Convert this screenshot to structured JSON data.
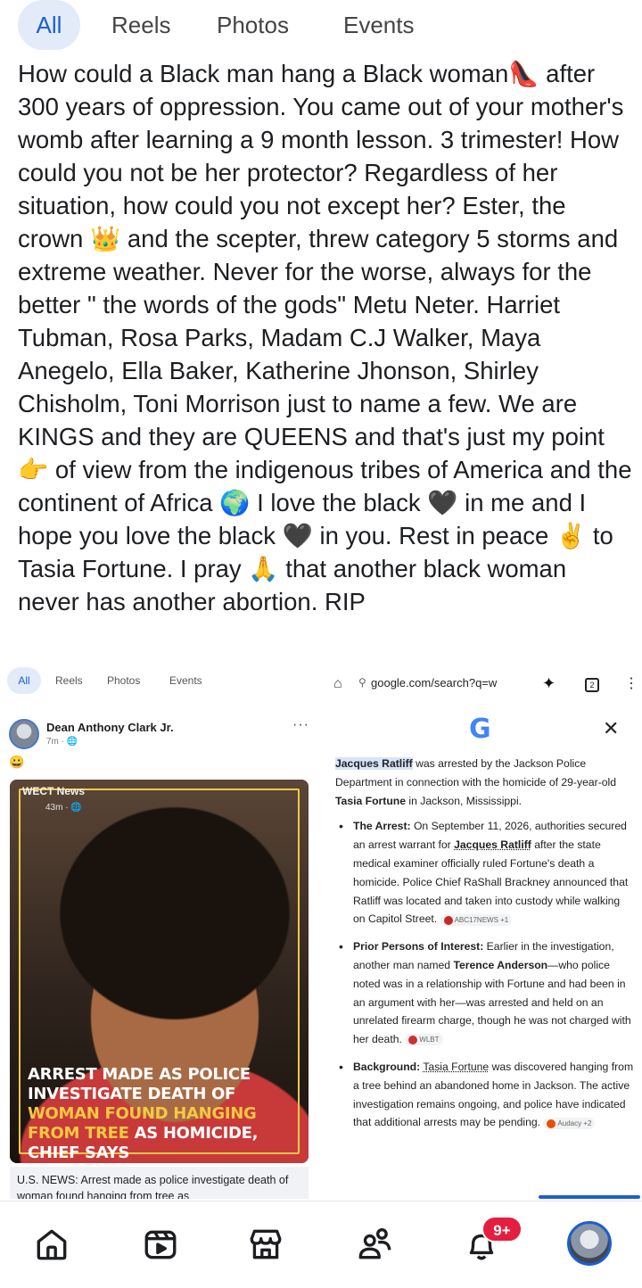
{
  "top_tabs": [
    "All",
    "Reels",
    "Photos",
    "Events"
  ],
  "post": {
    "segments": [
      {
        "t": "How could a Black man hang a Black woman"
      },
      {
        "e": "👠"
      },
      {
        "t": " after 300 years of oppression. You came out of your mother's womb after learning a 9 month lesson. 3 trimester! How could you not be her protector? Regardless of her situation, how could you not except her? Ester, the crown "
      },
      {
        "e": "👑"
      },
      {
        "t": " and the scepter, threw category 5 storms and extreme weather. Never for the worse, always for the better \" the words of the gods\" Metu Neter. Harriet Tubman, Rosa Parks, Madam C.J Walker, Maya Anegelo, Ella Baker, Katherine Jhonson, Shirley Chisholm, Toni Morrison just to name a few. We are KINGS and they are QUEENS and that's just my point "
      },
      {
        "e": "👉"
      },
      {
        "t": " of view from the indigenous tribes of America and the continent of Africa "
      },
      {
        "e": "🌍"
      },
      {
        "t": " I love the black "
      },
      {
        "e": "🖤"
      },
      {
        "t": " in me and I hope you love the black "
      },
      {
        "e": "🖤"
      },
      {
        "t": " in you. Rest in peace "
      },
      {
        "e": "✌"
      },
      {
        "t": " to Tasia Fortune. I pray "
      },
      {
        "e": "🙏"
      },
      {
        "t": " that another black woman never has another abortion. RIP"
      }
    ]
  },
  "embedded_fb": {
    "tabs": [
      "All",
      "Reels",
      "Photos",
      "Events"
    ],
    "author": "Dean Anthony Clark Jr.",
    "meta": "7m · 🌐",
    "more": "···",
    "emoji": "😀",
    "card": {
      "source": "WECT News",
      "time": "43m · 🌐",
      "headline_a": "ARREST MADE AS POLICE INVESTIGATE DEATH OF ",
      "headline_b": "WOMAN FOUND HANGING FROM TREE",
      "headline_c": " AS HOMICIDE, CHIEF SAYS"
    },
    "caption": "U.S. NEWS: Arrest made as police investigate death of woman found hanging from tree as"
  },
  "embedded_google": {
    "url": "google.com/search?q=w",
    "tab_count": "2",
    "logo": "G",
    "intro_a": "Jacques Ratliff",
    "intro_b": " was arrested by the Jackson Police Department in connection with the homicide of 29-year-old ",
    "intro_c": "Tasia Fortune",
    "intro_d": " in Jackson, Mississippi.",
    "b1_title": "The Arrest:",
    "b1_a": " On September 11, 2026, authorities secured an arrest warrant for ",
    "b1_b": "Jacques Ratliff",
    "b1_c": " after the state medical examiner officially ruled Fortune's death a homicide. Police Chief RaShall Brackney announced that Ratliff was located and taken into custody while walking on Capitol Street.",
    "b1_src": "ABC17NEWS +1",
    "b2_title": "Prior Persons of Interest:",
    "b2_a": " Earlier in the investigation, another man named ",
    "b2_b": "Terence Anderson",
    "b2_c": "—who police noted was in a relationship with Fortune and had been in an argument with her—was arrested and held on an unrelated firearm charge, though he was not charged with her death.",
    "b2_src": "WLBT",
    "b3_title": "Background:",
    "b3_a": "Tasia Fortune",
    "b3_b": " was discovered hanging from a tree behind an abandoned home in Jackson. The active investigation remains ongoing, and police have indicated that additional arrests may be pending.",
    "b3_src": "Audacy +2"
  },
  "bottom_nav": {
    "items": [
      "home-icon",
      "video-icon",
      "marketplace-icon",
      "friends-icon",
      "notifications-icon",
      "profile-avatar"
    ],
    "notification_badge": "9+"
  },
  "colors": {
    "accent": "#1b5fd0",
    "tab_active_bg": "#e3ebf8",
    "badge": "#e41e3f",
    "headline_highlight": "#f7c842"
  }
}
